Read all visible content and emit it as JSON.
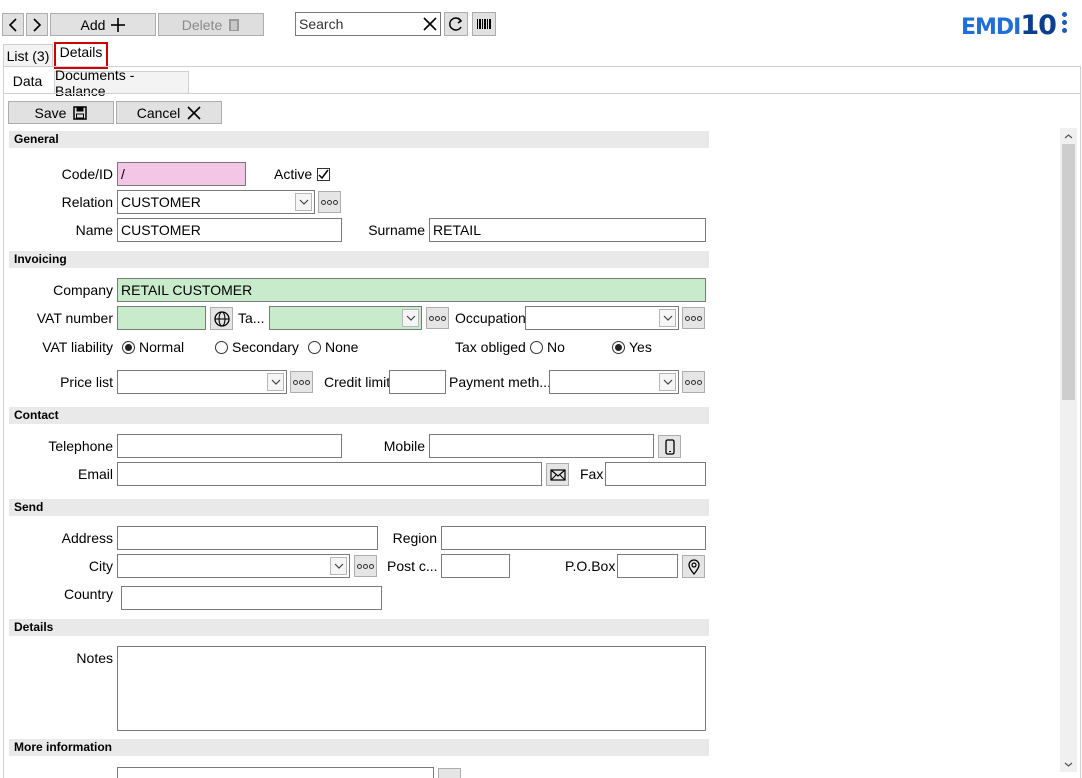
{
  "toolbar": {
    "add_label": "Add",
    "delete_label": "Delete",
    "search_placeholder": "Search"
  },
  "logo": {
    "text_main": "EMDI",
    "text_num": "10"
  },
  "tabs": {
    "list": "List (3)",
    "details": "Details"
  },
  "subtabs": {
    "data": "Data",
    "documents": "Documents - Balance"
  },
  "actions": {
    "save": "Save",
    "cancel": "Cancel"
  },
  "sections": {
    "general": "General",
    "invoicing": "Invoicing",
    "contact": "Contact",
    "send": "Send",
    "details": "Details",
    "more": "More information"
  },
  "general": {
    "code_label": "Code/ID",
    "code_value": "/",
    "active_label": "Active",
    "active_checked": true,
    "relation_label": "Relation",
    "relation_value": "CUSTOMER",
    "name_label": "Name",
    "name_value": "CUSTOMER",
    "surname_label": "Surname",
    "surname_value": "RETAIL"
  },
  "invoicing": {
    "company_label": "Company",
    "company_value": "RETAIL CUSTOMER",
    "vat_label": "VAT number",
    "vat_value": "",
    "tax_office_label": "Ta...",
    "tax_office_value": "",
    "occupation_label": "Occupation",
    "occupation_value": "",
    "vat_liability_label": "VAT liability",
    "vat_liability_options": [
      "Normal",
      "Secondary",
      "None"
    ],
    "vat_liability_selected": "Normal",
    "tax_obliged_label": "Tax obliged",
    "tax_obliged_options": [
      "No",
      "Yes"
    ],
    "tax_obliged_selected": "Yes",
    "price_list_label": "Price list",
    "price_list_value": "",
    "credit_limit_label": "Credit limit",
    "credit_limit_value": "",
    "payment_label": "Payment meth...",
    "payment_value": ""
  },
  "contact": {
    "telephone_label": "Telephone",
    "telephone_value": "",
    "mobile_label": "Mobile",
    "mobile_value": "",
    "email_label": "Email",
    "email_value": "",
    "fax_label": "Fax",
    "fax_value": ""
  },
  "send": {
    "address_label": "Address",
    "address_value": "",
    "region_label": "Region",
    "region_value": "",
    "city_label": "City",
    "city_value": "",
    "postcode_label": "Post c...",
    "postcode_value": "",
    "pobox_label": "P.O.Box",
    "pobox_value": "",
    "country_label": "Country",
    "country_value": ""
  },
  "details": {
    "notes_label": "Notes",
    "notes_value": ""
  },
  "colors": {
    "required_pink": "#f4c6e6",
    "filled_green": "#c8ebcc",
    "highlight_red": "#d00000",
    "brand_blue": "#1e6fd9"
  }
}
